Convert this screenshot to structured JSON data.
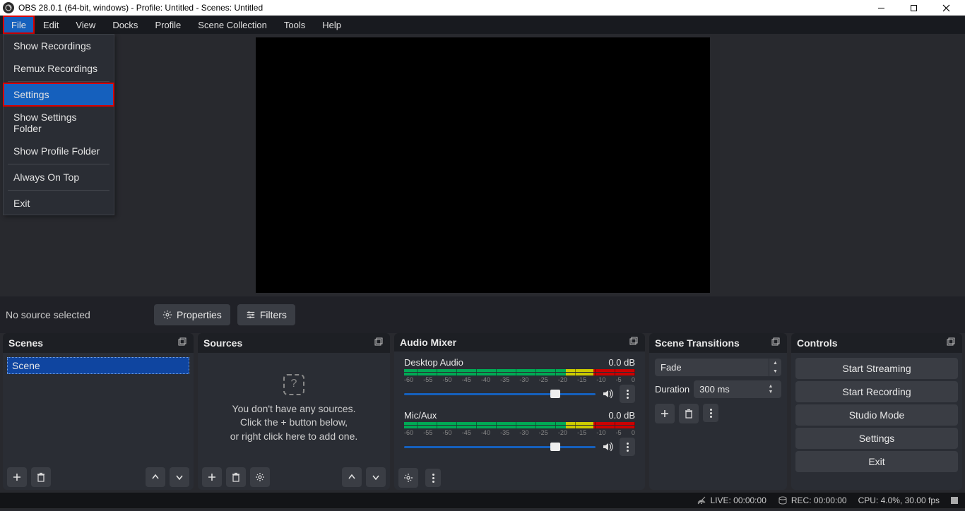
{
  "window": {
    "title": "OBS 28.0.1 (64-bit, windows) - Profile: Untitled - Scenes: Untitled"
  },
  "menubar": {
    "file": "File",
    "edit": "Edit",
    "view": "View",
    "docks": "Docks",
    "profile": "Profile",
    "scene_collection": "Scene Collection",
    "tools": "Tools",
    "help": "Help"
  },
  "file_menu": {
    "show_recordings": "Show Recordings",
    "remux_recordings": "Remux Recordings",
    "settings": "Settings",
    "show_settings_folder": "Show Settings Folder",
    "show_profile_folder": "Show Profile Folder",
    "always_on_top": "Always On Top",
    "exit": "Exit"
  },
  "toolbar": {
    "no_source": "No source selected",
    "properties": "Properties",
    "filters": "Filters"
  },
  "panels": {
    "scenes": {
      "title": "Scenes",
      "items": [
        "Scene"
      ]
    },
    "sources": {
      "title": "Sources",
      "empty_l1": "You don't have any sources.",
      "empty_l2": "Click the + button below,",
      "empty_l3": "or right click here to add one."
    },
    "mixer": {
      "title": "Audio Mixer",
      "ticks": [
        "-60",
        "-55",
        "-50",
        "-45",
        "-40",
        "-35",
        "-30",
        "-25",
        "-20",
        "-15",
        "-10",
        "-5",
        "0"
      ],
      "channels": [
        {
          "name": "Desktop Audio",
          "level": "0.0 dB"
        },
        {
          "name": "Mic/Aux",
          "level": "0.0 dB"
        }
      ]
    },
    "transitions": {
      "title": "Scene Transitions",
      "current": "Fade",
      "duration_label": "Duration",
      "duration_value": "300 ms"
    },
    "controls": {
      "title": "Controls",
      "start_streaming": "Start Streaming",
      "start_recording": "Start Recording",
      "studio_mode": "Studio Mode",
      "settings": "Settings",
      "exit": "Exit"
    }
  },
  "status": {
    "live": "LIVE: 00:00:00",
    "rec": "REC: 00:00:00",
    "cpu": "CPU: 4.0%, 30.00 fps"
  }
}
